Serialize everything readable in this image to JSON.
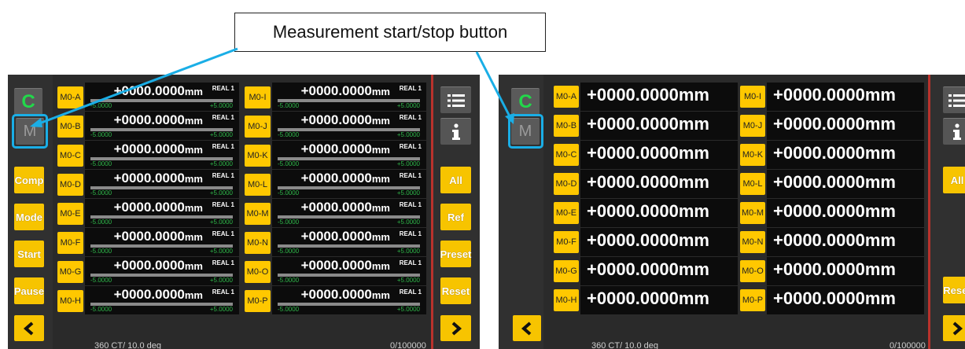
{
  "callout": {
    "label": "Measurement start/stop button"
  },
  "left_screen": {
    "c_button": "C",
    "m_button": "M",
    "side_buttons": [
      "Comp",
      "Mode",
      "Start",
      "Pause"
    ],
    "right_buttons": [
      "All",
      "Ref",
      "Preset",
      "Reset"
    ],
    "value": "+0000.0000",
    "unit": "mm",
    "mode_tag": "REAL 1",
    "range_low": "-5.0000",
    "range_high": "+5.0000",
    "channels_col1": [
      "M0-A",
      "M0-B",
      "M0-C",
      "M0-D",
      "M0-E",
      "M0-F",
      "M0-G",
      "M0-H"
    ],
    "channels_col2": [
      "M0-I",
      "M0-J",
      "M0-K",
      "M0-L",
      "M0-M",
      "M0-N",
      "M0-O",
      "M0-P"
    ],
    "footer_left": "360 CT/  10.0 deg",
    "footer_right": "0/100000"
  },
  "right_screen": {
    "c_button": "C",
    "m_button": "M",
    "right_buttons": [
      "All",
      "Reset"
    ],
    "value": "+0000.0000mm",
    "channels_col1": [
      "M0-A",
      "M0-B",
      "M0-C",
      "M0-D",
      "M0-E",
      "M0-F",
      "M0-G",
      "M0-H"
    ],
    "channels_col2": [
      "M0-I",
      "M0-J",
      "M0-K",
      "M0-L",
      "M0-M",
      "M0-N",
      "M0-O",
      "M0-P"
    ],
    "footer_left": "360 CT/  10.0 deg",
    "footer_right": "0/100000"
  },
  "colors": {
    "accent_yellow": "#f7c400",
    "highlight_blue": "#1aaee6",
    "divider_red": "#b9322c",
    "status_green": "#22d84a"
  },
  "icons": [
    "menu-list-icon",
    "info-icon",
    "chevron-left-icon",
    "chevron-right-icon"
  ]
}
